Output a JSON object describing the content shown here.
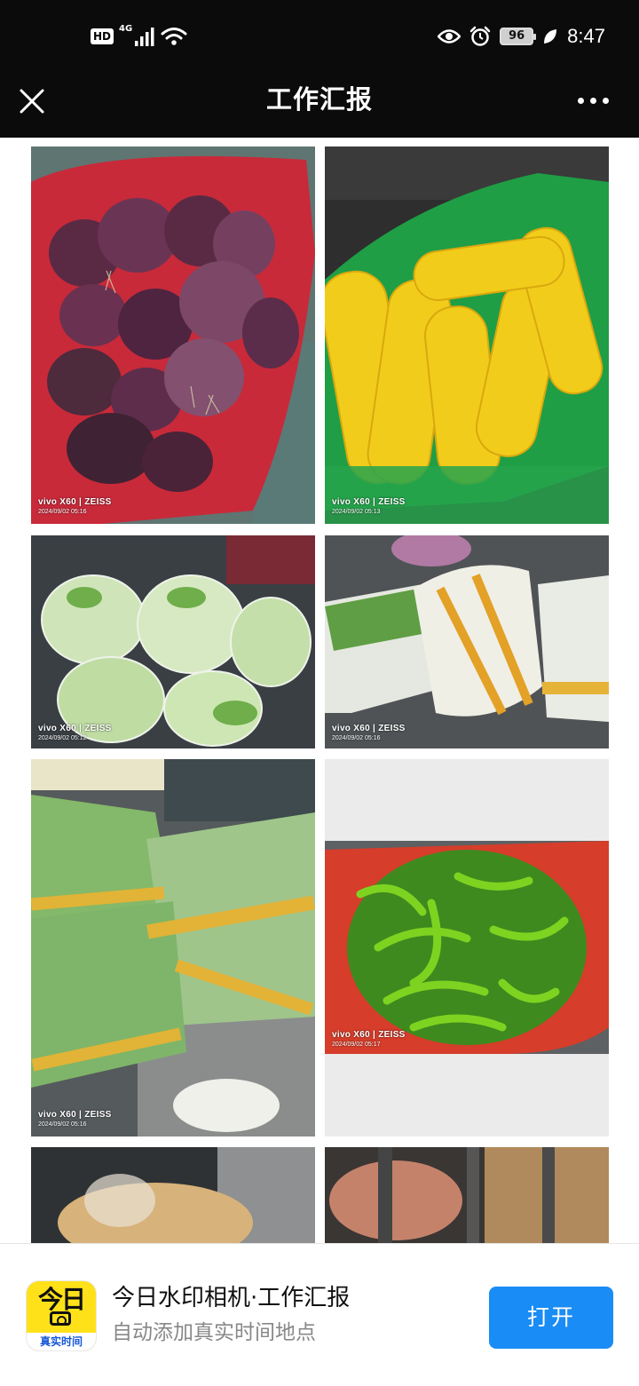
{
  "status_bar": {
    "hd": "HD",
    "network": "4G",
    "battery": "96",
    "time": "8:47"
  },
  "nav": {
    "title": "工作汇报"
  },
  "photos": [
    {
      "camera": "vivo X60 | ZEISS",
      "timestamp": "2024/09/02 05:16"
    },
    {
      "camera": "vivo X60 | ZEISS",
      "timestamp": "2024/09/02 05:13"
    },
    {
      "camera": "vivo X60 | ZEISS",
      "timestamp": "2024/09/02 05:12"
    },
    {
      "camera": "vivo X60 | ZEISS",
      "timestamp": "2024/09/02 05:16"
    },
    {
      "camera": "vivo X60 | ZEISS",
      "timestamp": "2024/09/02 05:16"
    },
    {
      "camera": "vivo X60 | ZEISS",
      "timestamp": "2024/09/02 05:17"
    }
  ],
  "banner": {
    "app_icon_text": "今日",
    "app_icon_strip": "真实时间",
    "title": "今日水印相机·工作汇报",
    "subtitle": "自动添加真实时间地点",
    "open_button": "打开"
  },
  "colors": {
    "header_bg": "#0b0b0b",
    "open_button": "#1a8cf5",
    "app_icon_bg": "#ffe11a"
  }
}
